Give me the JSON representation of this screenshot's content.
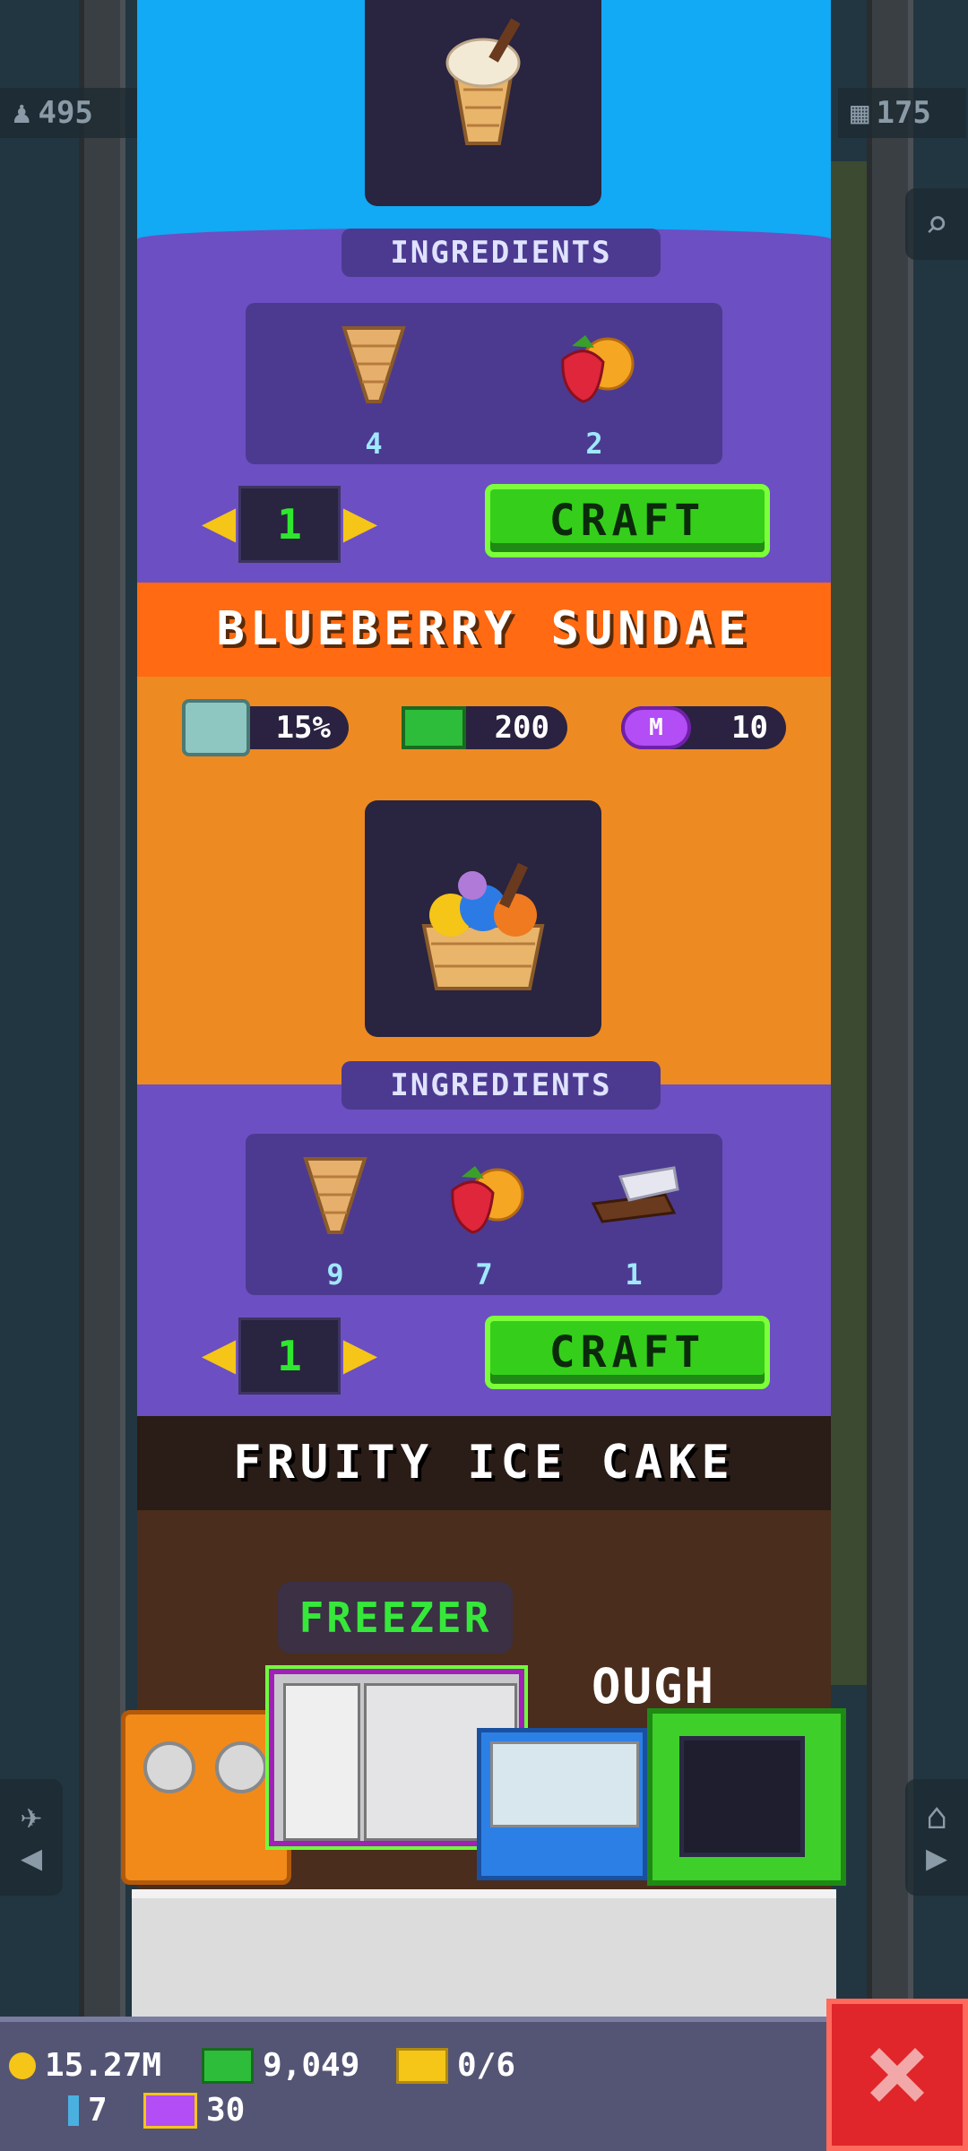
{
  "hud": {
    "population": "495",
    "floors": "175"
  },
  "panel": {
    "recipe_top": {
      "ingredients_label": "INGREDIENTS",
      "ingredients": [
        {
          "icon": "cone-icon",
          "count": "4"
        },
        {
          "icon": "fruit-icon",
          "count": "2"
        }
      ],
      "quantity": "1",
      "craft_label": "CRAFT"
    },
    "recipe_blueberry": {
      "title": "BLUEBERRY SUNDAE",
      "stats": {
        "bonus": "15%",
        "bux": "200",
        "mega": "10"
      },
      "ingredients_label": "INGREDIENTS",
      "ingredients": [
        {
          "icon": "cone-icon",
          "count": "9"
        },
        {
          "icon": "fruit-icon",
          "count": "7"
        },
        {
          "icon": "chocolate-icon",
          "count": "1"
        }
      ],
      "quantity": "1",
      "craft_label": "CRAFT"
    },
    "recipe_fruity": {
      "title": "FRUITY ICE CAKE"
    }
  },
  "machines": {
    "freezer_label": "FREEZER",
    "partial_text": "OUGH"
  },
  "bottom_bar": {
    "coins": "15.27M",
    "bux": "9,049",
    "tickets": "0/6",
    "keys": "7",
    "vip": "30"
  },
  "colors": {
    "blue": "#12a9f5",
    "purple": "#6c4fc2",
    "orange_title": "#ff6a12",
    "orange": "#ee8a22",
    "craft_green": "#35cf1b",
    "close_red": "#e0262a"
  }
}
